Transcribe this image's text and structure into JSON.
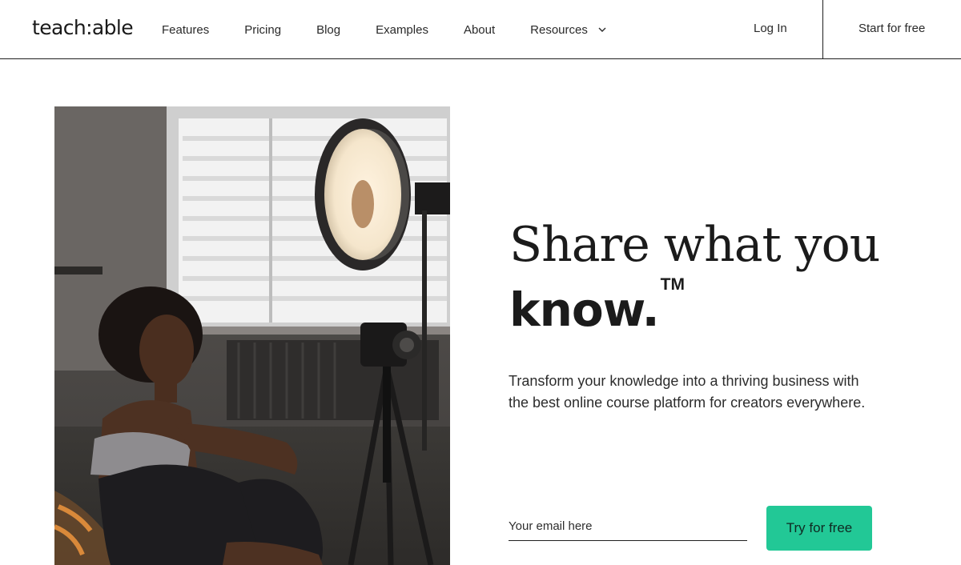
{
  "nav": {
    "logo": "teach:able",
    "links": [
      "Features",
      "Pricing",
      "Blog",
      "Examples",
      "About",
      "Resources"
    ],
    "resources_icon": "chevron-down-icon",
    "login": "Log In",
    "start": "Start for free"
  },
  "hero": {
    "headline_line1": "Share what you",
    "headline_line2": "know.",
    "trademark": "TM",
    "subtitle": "Transform your knowledge into a thriving business with the best online course platform for creators everywhere.",
    "email_placeholder": "Your email here",
    "cta": "Try for free",
    "photo": "woman-filming-with-ring-light-photo"
  },
  "colors": {
    "accent": "#22c896",
    "text": "#1b1b1b",
    "rule": "#1f1f1f"
  }
}
